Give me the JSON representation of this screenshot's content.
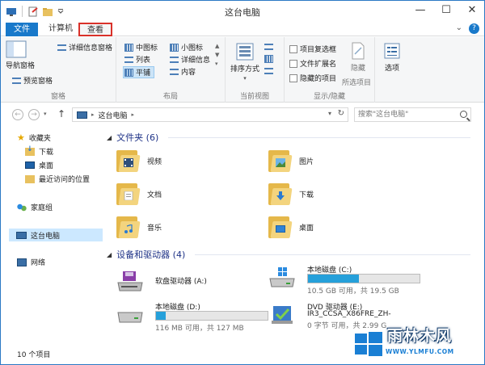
{
  "window": {
    "title": "这台电脑"
  },
  "ribbon_tabs": {
    "file": "文件",
    "computer": "计算机",
    "view": "查看"
  },
  "ribbon": {
    "nav_pane": "导航窗格",
    "preview_pane": "预览窗格",
    "details_pane": "详细信息窗格",
    "pane_group": "窗格",
    "layout": {
      "medium_icons": "中图标",
      "small_icons": "小图标",
      "list": "列表",
      "details": "详细信息",
      "tiles": "平铺",
      "content": "内容",
      "group": "布局"
    },
    "sort_by": "排序方式",
    "current_view_group": "当前视图",
    "item_checkboxes": "项目复选框",
    "file_extensions": "文件扩展名",
    "hidden_items": "隐藏的项目",
    "hide": "隐藏",
    "selected_items": "所选项目",
    "options": "选项",
    "show_hide_group": "显示/隐藏"
  },
  "address": {
    "location": "这台电脑",
    "search_placeholder": "搜索\"这台电脑\""
  },
  "nav_pane": {
    "favorites": "收藏夹",
    "downloads": "下载",
    "desktop": "桌面",
    "recent": "最近访问的位置",
    "homegroup": "家庭组",
    "this_pc": "这台电脑",
    "network": "网络"
  },
  "folders": {
    "header": "文件夹 (6)",
    "items": [
      "视频",
      "图片",
      "文档",
      "下载",
      "音乐",
      "桌面"
    ]
  },
  "drives": {
    "header": "设备和驱动器 (4)",
    "floppy": {
      "name": "软盘驱动器 (A:)"
    },
    "c": {
      "name": "本地磁盘 (C:)",
      "info": "10.5 GB 可用，共 19.5 GB",
      "used_fraction": 0.46
    },
    "d": {
      "name": "本地磁盘 (D:)",
      "info": "116 MB 可用，共 127 MB",
      "used_fraction": 0.09
    },
    "e": {
      "name": "DVD 驱动器 (E:)",
      "label": "IR3_CCSA_X86FRE_ZH-",
      "info": "0 字节 可用，共 2.99 G"
    }
  },
  "status": {
    "items": "10 个项目"
  },
  "watermark": {
    "text": "雨林木风",
    "url": "WWW.YLMFU.COM"
  },
  "colors": {
    "accent": "#1979ca",
    "drive_bar": "#26a0da",
    "section_header": "#1e3287"
  }
}
